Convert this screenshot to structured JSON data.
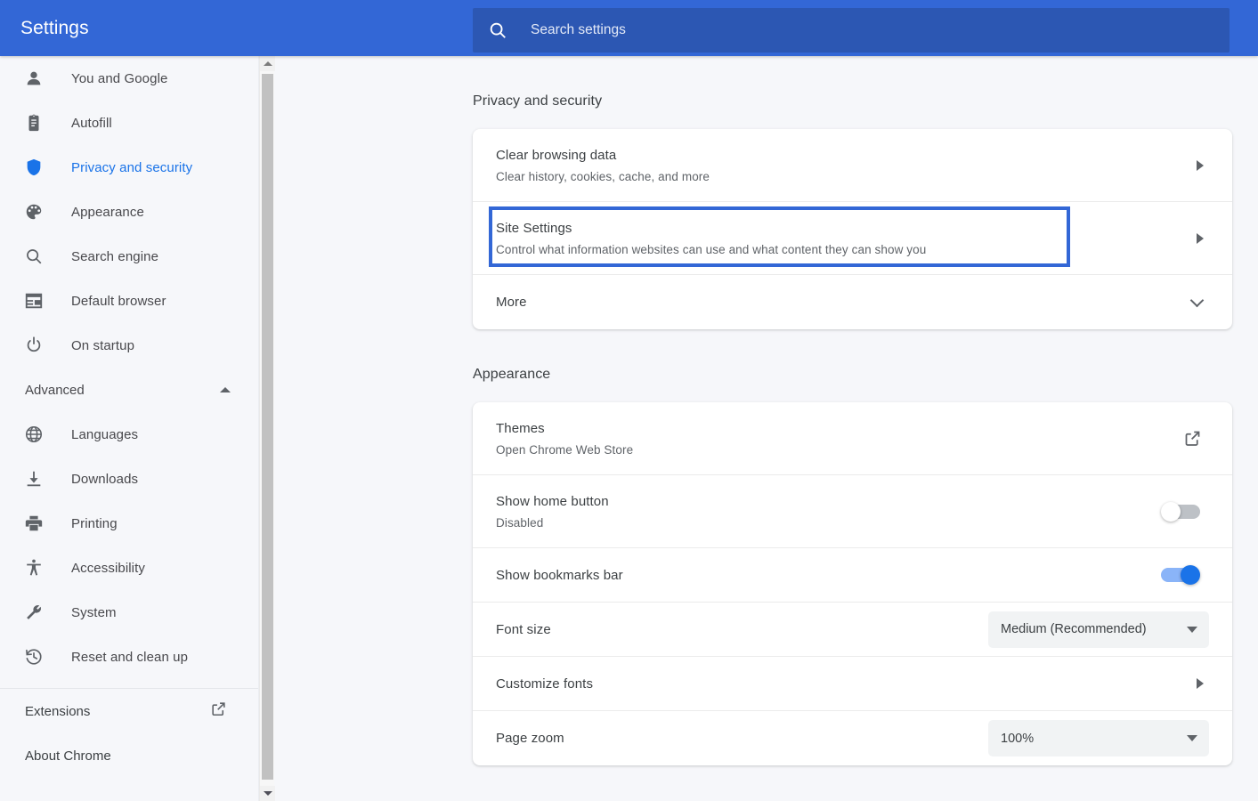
{
  "header": {
    "title": "Settings",
    "search_placeholder": "Search settings",
    "search_value": "",
    "search_icon": "search-icon",
    "bg_color": "#3367d6",
    "search_bg_color": "#2c57b3"
  },
  "sidebar": {
    "items": [
      {
        "label": "You and Google",
        "icon": "person-icon",
        "active": false
      },
      {
        "label": "Autofill",
        "icon": "clipboard-icon",
        "active": false
      },
      {
        "label": "Privacy and security",
        "icon": "shield-icon",
        "active": true
      },
      {
        "label": "Appearance",
        "icon": "palette-icon",
        "active": false
      },
      {
        "label": "Search engine",
        "icon": "magnifier-icon",
        "active": false
      },
      {
        "label": "Default browser",
        "icon": "browser-window-icon",
        "active": false
      },
      {
        "label": "On startup",
        "icon": "power-icon",
        "active": false
      }
    ],
    "advanced": {
      "label": "Advanced",
      "expanded": true,
      "icon": "chevron-up-icon"
    },
    "advanced_items": [
      {
        "label": "Languages",
        "icon": "globe-icon"
      },
      {
        "label": "Downloads",
        "icon": "download-icon"
      },
      {
        "label": "Printing",
        "icon": "printer-icon"
      },
      {
        "label": "Accessibility",
        "icon": "accessibility-icon"
      },
      {
        "label": "System",
        "icon": "wrench-icon"
      },
      {
        "label": "Reset and clean up",
        "icon": "history-restore-icon"
      }
    ],
    "footer_items": [
      {
        "label": "Extensions",
        "icon": "external-link-icon"
      },
      {
        "label": "About Chrome",
        "icon": ""
      }
    ],
    "active_color": "#1a73e8"
  },
  "main": {
    "sections": [
      {
        "title": "Privacy and security",
        "rows": [
          {
            "title": "Clear browsing data",
            "sub": "Clear history, cookies, cache, and more",
            "control": "arrow",
            "highlighted": false
          },
          {
            "title": "Site Settings",
            "sub": "Control what information websites can use and what content they can show you",
            "control": "arrow",
            "highlighted": true
          },
          {
            "title": "More",
            "sub": "",
            "control": "chevron-down",
            "highlighted": false
          }
        ]
      },
      {
        "title": "Appearance",
        "rows": [
          {
            "title": "Themes",
            "sub": "Open Chrome Web Store",
            "control": "external-link",
            "highlighted": false
          },
          {
            "title": "Show home button",
            "sub": "Disabled",
            "control": "toggle-off",
            "highlighted": false
          },
          {
            "title": "Show bookmarks bar",
            "sub": "",
            "control": "toggle-on",
            "highlighted": false
          },
          {
            "title": "Font size",
            "sub": "",
            "control": "select",
            "select_value": "Medium (Recommended)",
            "highlighted": false
          },
          {
            "title": "Customize fonts",
            "sub": "",
            "control": "arrow",
            "highlighted": false
          },
          {
            "title": "Page zoom",
            "sub": "",
            "control": "select",
            "select_value": "100%",
            "highlighted": false
          }
        ]
      }
    ],
    "highlight_color": "#3367d6"
  }
}
